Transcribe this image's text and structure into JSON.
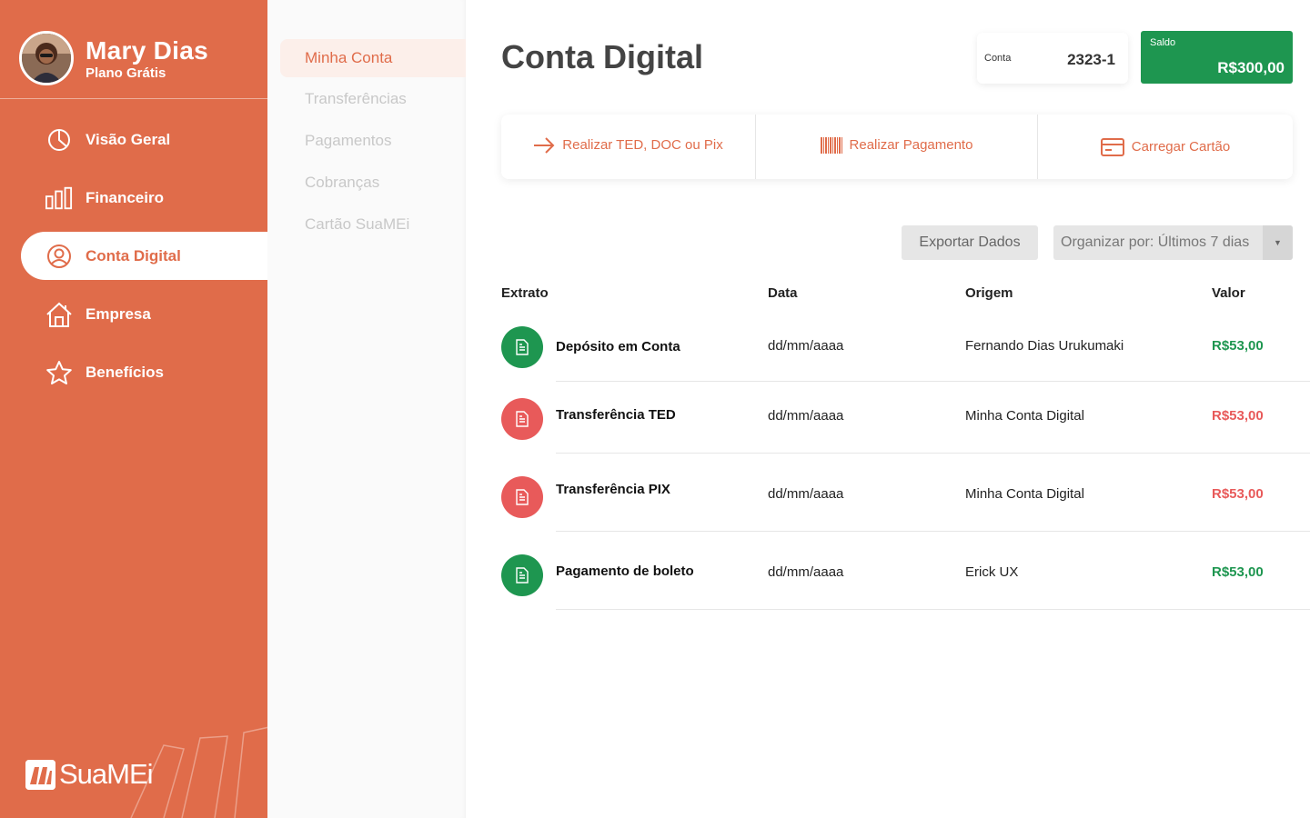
{
  "profile": {
    "name": "Mary Dias",
    "plan": "Plano Grátis"
  },
  "nav": [
    {
      "label": "Visão Geral",
      "icon": "pie-chart-icon"
    },
    {
      "label": "Financeiro",
      "icon": "bar-chart-icon"
    },
    {
      "label": "Conta Digital",
      "icon": "user-circle-icon",
      "active": true
    },
    {
      "label": "Empresa",
      "icon": "home-icon"
    },
    {
      "label": "Benefícios",
      "icon": "star-icon"
    }
  ],
  "brand": {
    "name": "SuaMEi"
  },
  "submenu": [
    {
      "label": "Minha Conta",
      "active": true
    },
    {
      "label": "Transferências"
    },
    {
      "label": "Pagamentos"
    },
    {
      "label": "Cobranças"
    },
    {
      "label": "Cartão SuaMEi"
    }
  ],
  "page": {
    "title": "Conta Digital"
  },
  "account": {
    "label": "Conta",
    "number": "2323-1"
  },
  "balance": {
    "label": "Saldo",
    "value": "R$300,00"
  },
  "actions": [
    {
      "label": "Realizar TED, DOC ou Pix",
      "icon": "arrow-right-icon"
    },
    {
      "label": "Realizar Pagamento",
      "icon": "barcode-icon"
    },
    {
      "label": "Carregar Cartão",
      "icon": "credit-card-icon"
    }
  ],
  "toolbar": {
    "export_label": "Exportar Dados",
    "sort_label": "Organizar por: Últimos 7 dias"
  },
  "table": {
    "headers": {
      "extrato": "Extrato",
      "data": "Data",
      "origem": "Origem",
      "valor": "Valor"
    },
    "rows": [
      {
        "title": "Depósito em Conta",
        "date": "dd/mm/aaaa",
        "origin": "Fernando Dias Urukumaki",
        "value": "R$53,00",
        "type": "credit"
      },
      {
        "title": "Transferência TED",
        "date": "dd/mm/aaaa",
        "origin": "Minha Conta Digital",
        "value": "R$53,00",
        "type": "debit"
      },
      {
        "title": "Transferência PIX",
        "date": "dd/mm/aaaa",
        "origin": "Minha Conta Digital",
        "value": "R$53,00",
        "type": "debit"
      },
      {
        "title": "Pagamento de boleto",
        "date": "dd/mm/aaaa",
        "origin": "Erick UX",
        "value": "R$53,00",
        "type": "credit"
      }
    ]
  },
  "colors": {
    "brand": "#e06c4a",
    "credit": "#1e9650",
    "debit": "#e85a5a"
  }
}
